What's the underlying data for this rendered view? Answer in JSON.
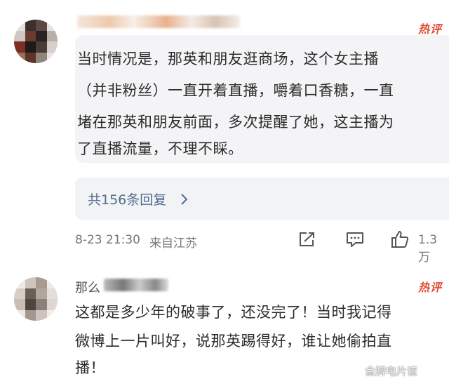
{
  "comment1": {
    "badge": "热评",
    "text_lines": [
      "当时情况是，那英和朋友逛商场，这个女主播",
      "（并非粉丝）一直开着直播，嚼着口香糖，一直",
      "堵在那英和朋友前面，多次提醒了她，这主播为",
      "了直播流量，不理不睬。"
    ],
    "replies_label": "共156条回复",
    "timestamp": "8-23 21:30",
    "location": "来自江苏",
    "like_count": "1.3万",
    "icons": [
      "share-icon",
      "comment-icon",
      "like-icon",
      "chevron-right-icon"
    ]
  },
  "comment2": {
    "username": "那么",
    "badge": "热评",
    "text_lines": [
      "这都是多少年的破事了，还没完了！当时我记得",
      "微博上一片叫好，说那英踢得好，谁让她偷拍直",
      "播！"
    ]
  },
  "watermark": "金牌电片谊",
  "colors": {
    "badge": "#e14b34",
    "replies_link": "#506b8e",
    "comment_bg": "#f4f4f6"
  }
}
